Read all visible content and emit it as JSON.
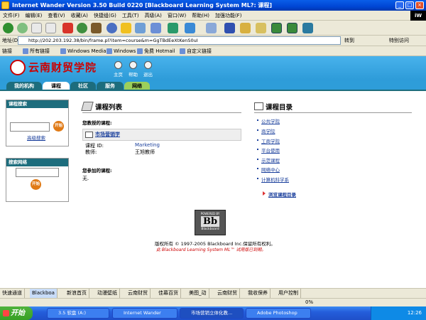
{
  "window": {
    "title": "Internet Wander Version 3.50 Build 0220  [Blackboard Learning System ML?: 课程]"
  },
  "menu": [
    "文件(F)",
    "编辑(E)",
    "查看(V)",
    "收藏(A)",
    "快捷组(G)",
    "工具(T)",
    "高级(A)",
    "窗口(W)",
    "帮助(H)",
    "加强功能(F)"
  ],
  "brand_logo": "iW",
  "address": {
    "label": "地址(D)",
    "url": "http://202.203.192.38/bin/frame.pl?item=course&m=GgTBdEeXtKenS0uI",
    "go": "转到",
    "special": "特别访问"
  },
  "links": {
    "label": "链接",
    "items": [
      "所有链接",
      "Windows Media",
      "Windows",
      "免费 Hotmail",
      "自定义链接"
    ]
  },
  "header": {
    "site_name": "云南财贸学院",
    "icons": [
      "主页",
      "帮助",
      "退出"
    ]
  },
  "tabs": [
    "我的机构",
    "课程",
    "社区",
    "服务",
    "网络"
  ],
  "left": {
    "course_search": {
      "title": "课程搜索",
      "go": "开始",
      "advanced": "高级搜索"
    },
    "web_search": {
      "title": "搜索网络",
      "go": "开始"
    }
  },
  "courses": {
    "title": "课程列表",
    "teaching_label": "您教授的课程:",
    "course_name": "市场营销学",
    "course_id_label": "课程 ID:",
    "course_id": "Marketing",
    "instructor_label": "教师:",
    "instructor": "王旭教师",
    "enrolled_label": "您参加的课程:",
    "enrolled_none": "无."
  },
  "catalog": {
    "title": "课程目录",
    "items": [
      "公共学院",
      "商学院",
      "工商学院",
      "平台使用",
      "示范课程",
      "网络中心",
      "计算机科学系"
    ],
    "browse": "浏览课程目录"
  },
  "footer": {
    "badge_top": "POWERED BY",
    "badge_logo": "Bb",
    "badge_bottom": "Blackboard",
    "copyright": "版权所有 © 1997-2005 Blackboard Inc.保留所有权利。",
    "trial": "此 Blackboard Learning System ML™ 试用版已到期。"
  },
  "statusbar": [
    "快速通道",
    "Blackboa",
    "新浪首页",
    "动漫壁纸",
    "云南财贸",
    "佳幕百货",
    "美图_动",
    "云南财贸",
    "我收保养",
    "用户控制"
  ],
  "progress": "0%",
  "taskbar": {
    "start": "开始",
    "tasks": [
      "3.5 软盘 (A:)",
      "Internet Wander",
      "市场营销立体化教...",
      "Adobe Photoshop"
    ],
    "clock": "12:26"
  }
}
